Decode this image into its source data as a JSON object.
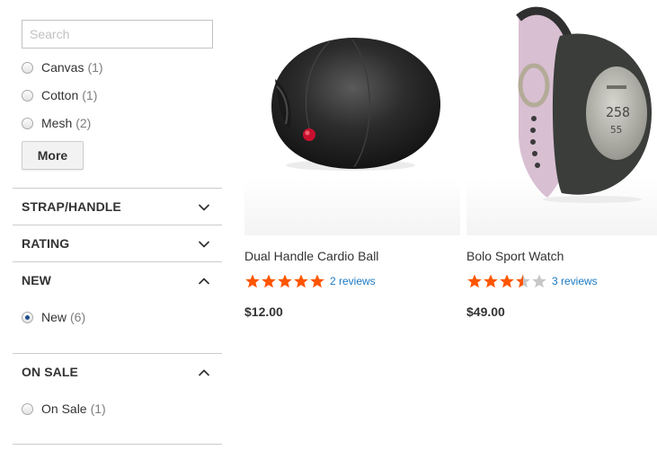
{
  "filters": {
    "search": {
      "placeholder": "Search",
      "value": ""
    },
    "material_options": [
      {
        "label": "Canvas",
        "count": "(1)"
      },
      {
        "label": "Cotton",
        "count": "(1)"
      },
      {
        "label": "Mesh",
        "count": "(2)"
      }
    ],
    "more_label": "More",
    "sections": [
      {
        "title": "STRAP/HANDLE",
        "expanded": false
      },
      {
        "title": "RATING",
        "expanded": false
      },
      {
        "title": "NEW",
        "expanded": true
      },
      {
        "title": "ON SALE",
        "expanded": true
      }
    ],
    "new_option": {
      "label": "New",
      "count": "(6)",
      "checked": true
    },
    "sale_option": {
      "label": "On Sale",
      "count": "(1)",
      "checked": false
    }
  },
  "products": [
    {
      "name": "Dual Handle Cardio Ball",
      "rating": 5,
      "reviews": "2 reviews",
      "price": "$12.00"
    },
    {
      "name": "Bolo Sport Watch",
      "rating": 3.5,
      "reviews": "3 reviews",
      "price": "$49.00"
    }
  ],
  "colors": {
    "star_filled": "#ff5501",
    "star_empty": "#c7c7c7",
    "link": "#1979c3",
    "divider": "#cccccc"
  }
}
